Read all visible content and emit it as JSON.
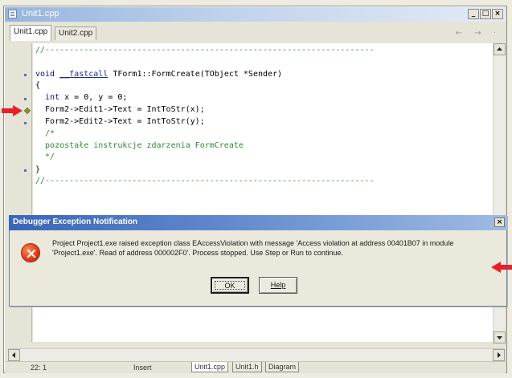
{
  "window": {
    "title": "Unit1.cpp",
    "caption_buttons": [
      "_",
      "□",
      "×"
    ]
  },
  "tabs": [
    {
      "label": "Unit1.cpp",
      "active": true
    },
    {
      "label": "Unit2.cpp",
      "active": false
    }
  ],
  "nav_arrows": "← → ·",
  "code_lines": {
    "l1": "//--------------------------------------------------------------------",
    "l3_a": "void ",
    "l3_b": "__fastcall",
    "l3_c": " TForm1::FormCreate(TObject *Sender)",
    "l4": "{",
    "l6_a": "  int",
    "l6_b": " x = 0, y = 0;",
    "l7": "  Form2->Edit1->Text = IntToStr(x);",
    "l8": "  Form2->Edit2->Text = IntToStr(y);",
    "l9": "  /*",
    "l10": "  pozostałe instrukcje zdarzenia FormCreate",
    "l11": "  */",
    "l12": "}",
    "l13": "//--------------------------------------------------------------------"
  },
  "dialog": {
    "title": "Debugger Exception Notification",
    "close": "×",
    "message": "Project Project1.exe raised exception class EAccessViolation with message 'Access violation at address 00401B07 in module 'Project1.exe'. Read of address 000002F0'. Process stopped. Use Step or Run to continue.",
    "ok_label": "OK",
    "help_label": "Help"
  },
  "status": {
    "position": "22: 1",
    "mode": "Insert",
    "bottom_tabs": [
      "Unit1.cpp",
      "Unit1.h",
      "Diagram"
    ]
  },
  "colors": {
    "arrow": "#e8202a",
    "code_comment": "#2f8a2f",
    "code_keyword": "#0b0b8c",
    "dialog_title": "#3a66b8"
  },
  "icons": {
    "error": "error-circle-x-icon",
    "breakpoint": "execution-point-icon",
    "arrow": "red-arrow-icon"
  }
}
